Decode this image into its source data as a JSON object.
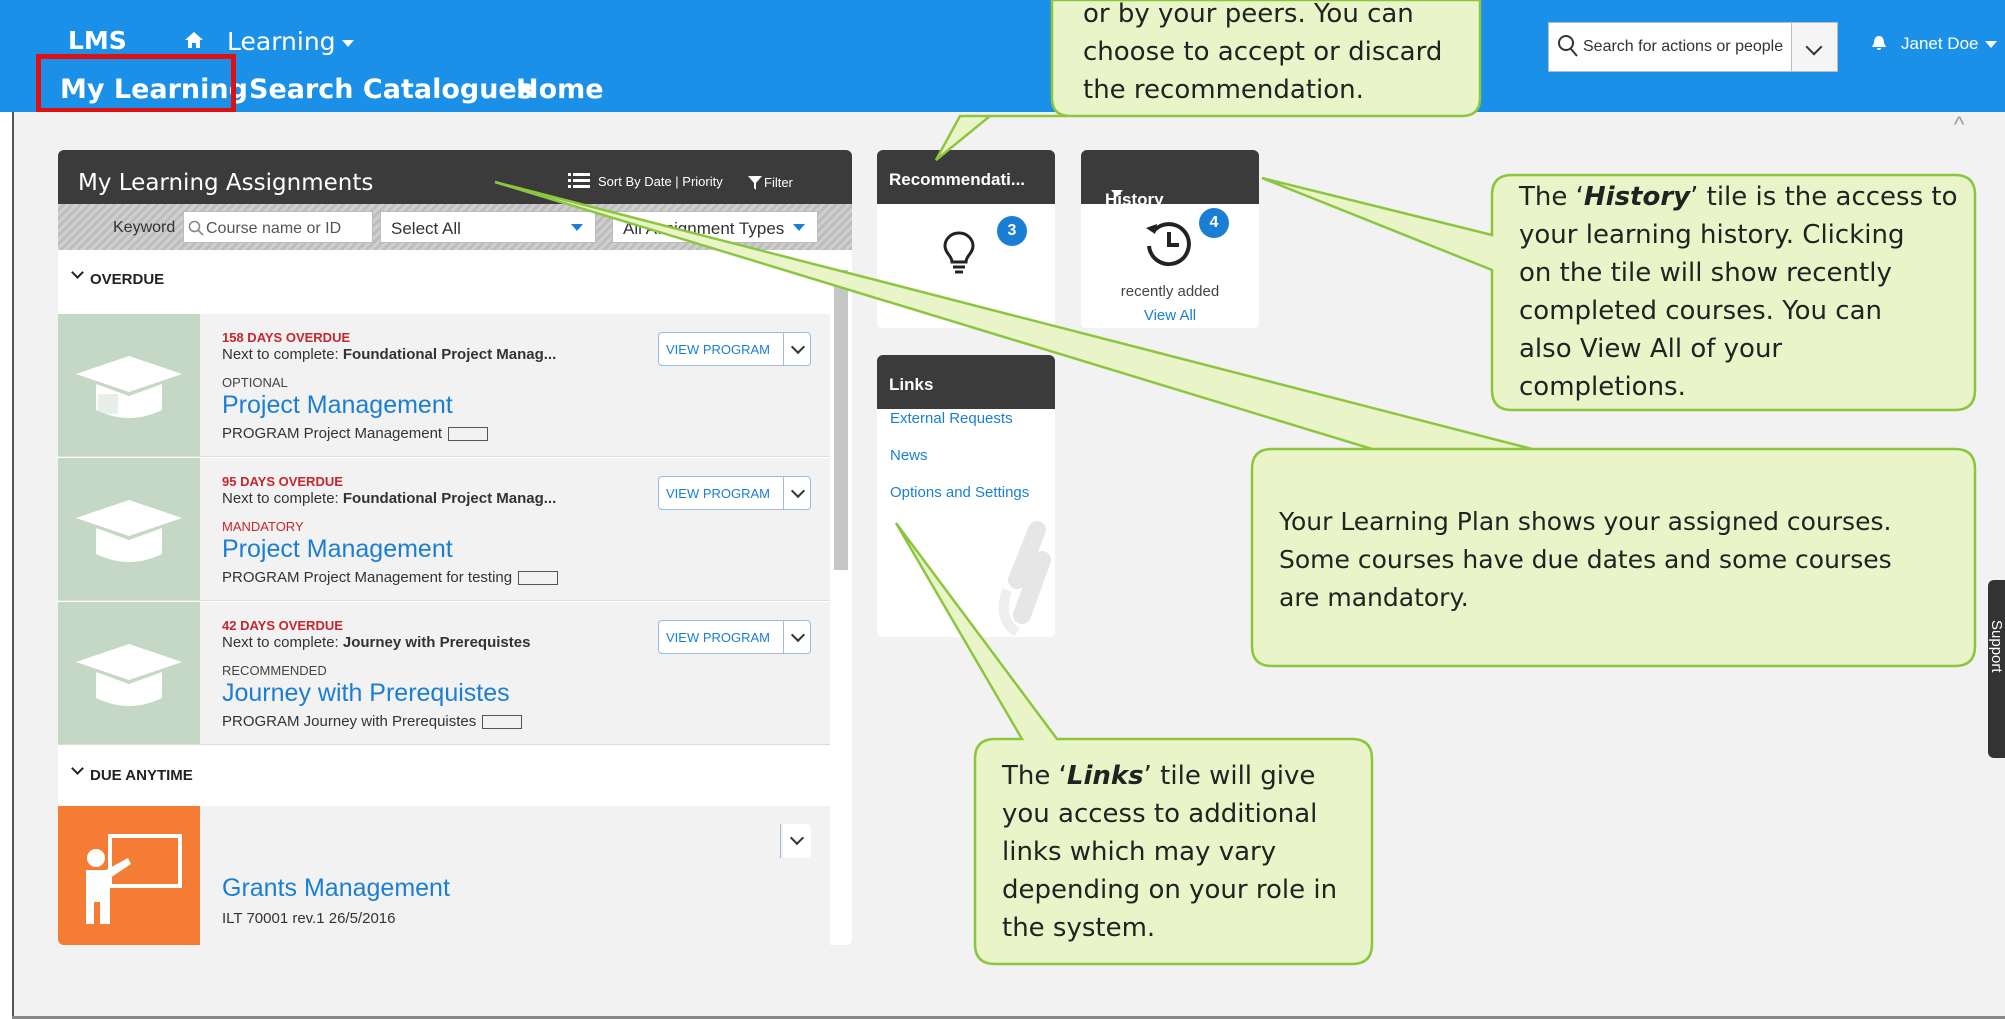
{
  "header": {
    "logo": "LMS",
    "menu_learning": "Learning",
    "tabs": [
      "My Learning",
      "Search Catalogues",
      "Home"
    ],
    "search_placeholder": "Search for actions or people",
    "user_name": "Janet Doe"
  },
  "panel": {
    "title": "My Learning Assignments",
    "sort_label": "Sort By Date | Priority",
    "filter_label": "Filter",
    "keyword_label": "Keyword",
    "keyword_placeholder": "Course name or ID",
    "select_all": "Select All",
    "assignment_types": "All Assignment Types",
    "sections": [
      {
        "label": "OVERDUE"
      },
      {
        "label": "DUE ANYTIME"
      }
    ],
    "rows": [
      {
        "overdue": "158 DAYS OVERDUE",
        "next_prefix": "Next to complete: ",
        "next_item": "Foundational Project Manag...",
        "tag": "OPTIONAL",
        "title": "Project Management",
        "sub": "PROGRAM Project Management",
        "button": "VIEW PROGRAM"
      },
      {
        "overdue": "95 DAYS OVERDUE",
        "next_prefix": "Next to complete: ",
        "next_item": "Foundational Project Manag...",
        "tag": "MANDATORY",
        "title": "Project Management",
        "sub": "PROGRAM Project Management for testing",
        "button": "VIEW PROGRAM"
      },
      {
        "overdue": "42 DAYS OVERDUE",
        "next_prefix": "Next to complete: ",
        "next_item": "Journey with Prerequistes",
        "tag": "RECOMMENDED",
        "title": "Journey with Prerequistes",
        "sub": "PROGRAM Journey with Prerequistes",
        "button": "VIEW PROGRAM"
      },
      {
        "title": "Grants Management",
        "sub": "ILT 70001 rev.1 26/5/2016"
      }
    ]
  },
  "tiles": {
    "recommendations": {
      "title": "Recommendati...",
      "count": "3"
    },
    "history": {
      "title": "History",
      "count": "4",
      "recently_added": "recently added",
      "view_all": "View All"
    },
    "links": {
      "title": "Links",
      "items": [
        "External Requests",
        "News",
        "Options and Settings"
      ]
    }
  },
  "callouts": {
    "recommendations": [
      "or by your peers.  You can",
      "choose to accept or discard",
      "the recommendation."
    ],
    "history_pre": "The ‘",
    "history_bold": "History",
    "history_post": "’ tile is the access to",
    "history_rest": [
      "your learning history.  Clicking",
      "on the tile will show recently",
      "completed courses.  You can",
      "also View All of your",
      "completions."
    ],
    "plan": [
      "Your Learning Plan shows your assigned courses.",
      "Some courses have due dates and some courses",
      "are mandatory."
    ],
    "links_pre": "The ‘",
    "links_bold": "Links",
    "links_post": "’ tile will give",
    "links_rest": [
      "you access to additional",
      "links which may vary",
      "depending on your role in",
      "the system."
    ]
  },
  "support_label": "Support",
  "colors": {
    "header": "#1a90e8",
    "overdue": "#c8262c",
    "link": "#1a7fd4",
    "callout_fill": "#e9f5c8",
    "callout_border": "#8cc63f",
    "highlight": "#e01010"
  }
}
